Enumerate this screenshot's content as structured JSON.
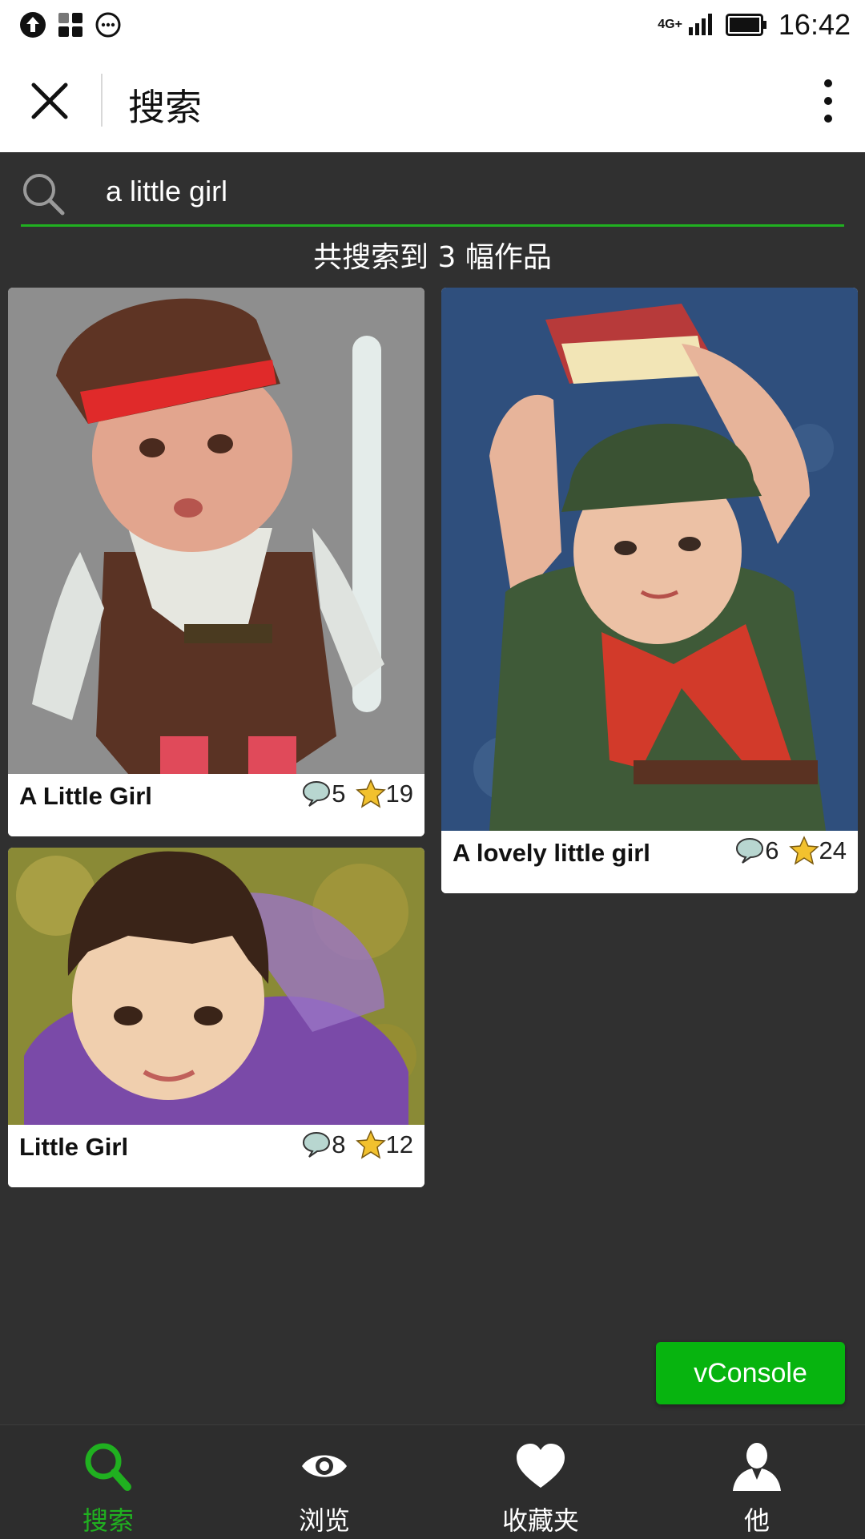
{
  "status_bar": {
    "network": "4G+",
    "time": "16:42"
  },
  "title_bar": {
    "title": "搜索"
  },
  "search": {
    "query": "a little girl"
  },
  "results": {
    "summary": "共搜索到 3 幅作品",
    "items": [
      {
        "title": "A Little Girl",
        "comments": "5",
        "stars": "19"
      },
      {
        "title": "A lovely little girl",
        "comments": "6",
        "stars": "24"
      },
      {
        "title": "Little Girl",
        "comments": "8",
        "stars": "12"
      }
    ]
  },
  "vconsole": {
    "label": "vConsole"
  },
  "tabs": [
    {
      "label": "搜索",
      "icon": "search-icon",
      "active": true
    },
    {
      "label": "浏览",
      "icon": "eye-icon",
      "active": false
    },
    {
      "label": "收藏夹",
      "icon": "heart-icon",
      "active": false
    },
    {
      "label": "他",
      "icon": "person-icon",
      "active": false
    }
  ],
  "colors": {
    "accent": "#20b020",
    "background": "#303030",
    "vconsole": "#07b40f",
    "star": "#f2c12e",
    "comment_bubble": "#b8d6d0"
  }
}
